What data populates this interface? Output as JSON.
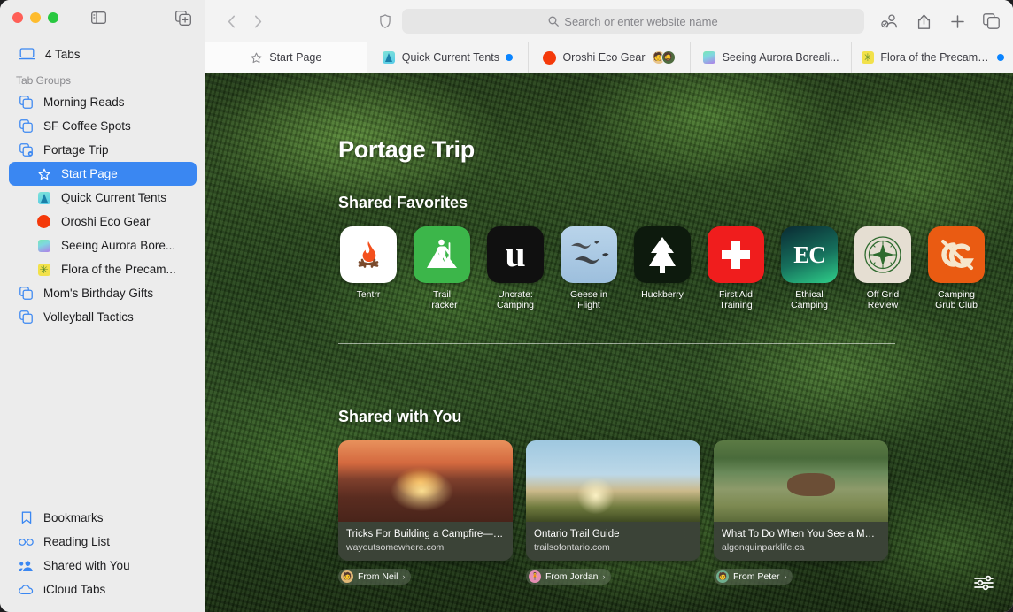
{
  "window": {
    "traffic_lights": [
      "close",
      "minimize",
      "zoom"
    ],
    "sidebar_toggle_icon": "sidebar-icon",
    "new_tab_group_icon": "new-tab-group-icon"
  },
  "sidebar": {
    "tabs_count_label": "4 Tabs",
    "tabs_count_icon": "laptop-icon",
    "group_header": "Tab Groups",
    "groups": [
      {
        "label": "Morning Reads",
        "icon": "tab-group-icon",
        "selected": false
      },
      {
        "label": "SF Coffee Spots",
        "icon": "tab-group-icon",
        "selected": false
      },
      {
        "label": "Portage Trip",
        "icon": "tab-group-shared-icon",
        "selected": false
      }
    ],
    "portage_tabs": [
      {
        "label": "Start Page",
        "icon": "star-icon",
        "selected": true
      },
      {
        "label": "Quick Current Tents",
        "icon": "tent-favicon",
        "selected": false
      },
      {
        "label": "Oroshi Eco Gear",
        "icon": "orange-circle-favicon",
        "selected": false
      },
      {
        "label": "Seeing Aurora Bore...",
        "icon": "aurora-favicon",
        "selected": false
      },
      {
        "label": "Flora of the Precam...",
        "icon": "flora-favicon",
        "selected": false
      }
    ],
    "groups_after": [
      {
        "label": "Mom's Birthday Gifts",
        "icon": "tab-group-icon",
        "selected": false
      },
      {
        "label": "Volleyball Tactics",
        "icon": "tab-group-icon",
        "selected": false
      }
    ],
    "bottom_items": [
      {
        "label": "Bookmarks",
        "icon": "bookmark-icon"
      },
      {
        "label": "Reading List",
        "icon": "glasses-icon"
      },
      {
        "label": "Shared with You",
        "icon": "people-icon"
      },
      {
        "label": "iCloud Tabs",
        "icon": "cloud-icon"
      }
    ]
  },
  "toolbar": {
    "back_icon": "chevron-left-icon",
    "forward_icon": "chevron-right-icon",
    "shield_icon": "privacy-shield-icon",
    "address_placeholder": "Search or enter website name",
    "search_icon": "search-icon",
    "right_buttons": [
      {
        "icon": "share-participants-icon"
      },
      {
        "icon": "share-icon"
      },
      {
        "icon": "new-tab-plus-icon"
      },
      {
        "icon": "tab-overview-icon"
      }
    ]
  },
  "tabbar": {
    "tabs": [
      {
        "label": "Start Page",
        "icon": "star-icon",
        "active": true,
        "badge": "none"
      },
      {
        "label": "Quick Current Tents",
        "icon": "tent-favicon",
        "active": false,
        "badge": "blue-dot"
      },
      {
        "label": "Oroshi Eco Gear",
        "icon": "orange-circle-favicon",
        "active": false,
        "badge": "avatars",
        "avatars": [
          "🧑🏽",
          "🧔🏿"
        ]
      },
      {
        "label": "Seeing Aurora Boreali...",
        "icon": "aurora-favicon",
        "active": false,
        "badge": "none"
      },
      {
        "label": "Flora of the Precambi...",
        "icon": "flora-favicon",
        "active": false,
        "badge": "blue-dot"
      }
    ]
  },
  "startpage": {
    "title": "Portage Trip",
    "favorites_heading": "Shared Favorites",
    "favorites": [
      {
        "name": "Tentrr",
        "caption": "Tentrr",
        "icon": "campfire-icon",
        "bg": "#ffffff",
        "fg": "#f3491a"
      },
      {
        "name": "Trail Tracker",
        "caption": "Trail\nTracker",
        "icon": "hiker-icon",
        "bg": "#3cb64a",
        "fg": "#ffffff"
      },
      {
        "name": "Uncrate: Camping",
        "caption": "Uncrate:\nCamping",
        "icon": "letter-u-icon",
        "bg": "#101010",
        "fg": "#ffffff"
      },
      {
        "name": "Geese in Flight",
        "caption": "Geese in\nFlight",
        "icon": "geese-icon",
        "bg": "#a9c8e2",
        "fg": "#3a4a58"
      },
      {
        "name": "Huckberry",
        "caption": "Huckberry",
        "icon": "pine-tree-icon",
        "bg": "#0d1b0d",
        "fg": "#ffffff"
      },
      {
        "name": "First Aid Training",
        "caption": "First Aid\nTraining",
        "icon": "cross-icon",
        "bg": "#f01d1d",
        "fg": "#ffffff"
      },
      {
        "name": "Ethical Camping",
        "caption": "Ethical\nCamping",
        "icon": "ec-monogram-icon",
        "bg": "#0b2f35",
        "fg": "#ffffff"
      },
      {
        "name": "Off Grid Review",
        "caption": "Off Grid\nReview",
        "icon": "compass-icon",
        "bg": "#e3ddd1",
        "fg": "#2f6b2f"
      },
      {
        "name": "Camping Grub Club",
        "caption": "Camping\nGrub Club",
        "icon": "cg-monogram-icon",
        "bg": "#ea5b12",
        "fg": "#f5e4c8"
      }
    ],
    "shared_heading": "Shared with You",
    "shared_cards": [
      {
        "title": "Tricks For Building a Campfire—F...",
        "url": "wayoutsomewhere.com",
        "from": "From Neil",
        "avatar": "🧑",
        "image": "campfire-photo"
      },
      {
        "title": "Ontario Trail Guide",
        "url": "trailsofontario.com",
        "from": "From Jordan",
        "avatar": "🧍",
        "image": "hikers-photo"
      },
      {
        "title": "What To Do When You See a Moo...",
        "url": "algonquinparklife.ca",
        "from": "From Peter",
        "avatar": "🧑",
        "image": "moose-photo"
      }
    ],
    "customize_icon": "sliders-icon"
  },
  "colors": {
    "accent": "#3a87f2",
    "sidebar_bg": "#ececec",
    "toolbar_bg": "#f3f3f3",
    "badge_blue": "#0a84ff"
  }
}
